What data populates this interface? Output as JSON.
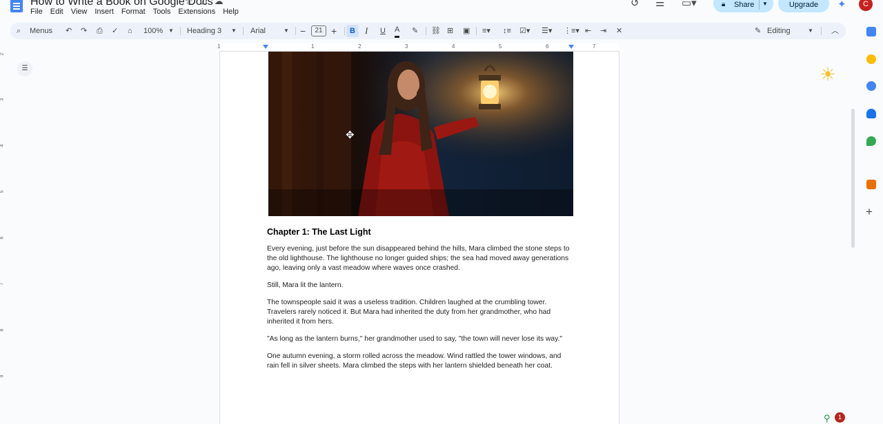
{
  "doc": {
    "title": "How to Write a Book on Google Docs",
    "menu": [
      "File",
      "Edit",
      "View",
      "Insert",
      "Format",
      "Tools",
      "Extensions",
      "Help"
    ]
  },
  "topbar": {
    "share_label": "Share",
    "upgrade_label": "Upgrade",
    "avatar_initial": "C"
  },
  "toolbar": {
    "search_label": "Menus",
    "zoom": "100%",
    "style": "Heading 3",
    "font": "Arial",
    "font_size": "21",
    "editing_mode": "Editing",
    "bold_active": true
  },
  "ruler": {
    "numbers": [
      "1",
      "1",
      "2",
      "3",
      "4",
      "5",
      "6",
      "7"
    ]
  },
  "content": {
    "heading": "Chapter 1: The Last Light",
    "paragraphs": [
      "Every evening, just before the sun disappeared behind the hills, Mara climbed the stone steps to the old lighthouse. The lighthouse no longer guided ships; the sea had moved away generations ago, leaving only a vast meadow where waves once crashed.",
      "Still, Mara lit the lantern.",
      "The townspeople said it was a useless tradition. Children laughed at the crumbling tower. Travelers rarely noticed it. But Mara had inherited the duty from her grandmother, who had inherited it from hers.",
      "\"As long as the lantern burns,\" her grandmother used to say, \"the town will never lose its way.\"",
      "One autumn evening, a storm rolled across the meadow. Wind rattled the tower windows, and rain fell in silver sheets. Mara climbed the steps with her lantern shielded beneath her coat."
    ]
  },
  "badges": {
    "notification_count": "1"
  },
  "colors": {
    "accent": "#0b57d0",
    "share_bg": "#c2e7ff",
    "avatar": "#c5221f"
  }
}
